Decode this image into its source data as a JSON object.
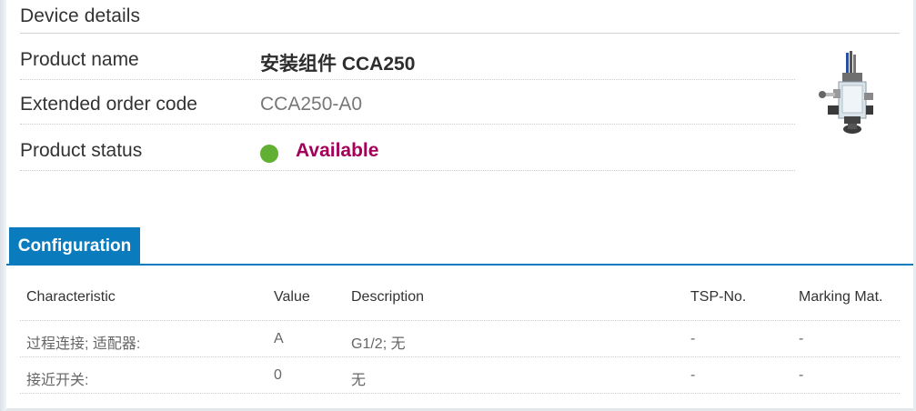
{
  "device_details": {
    "title": "Device details",
    "rows": [
      {
        "label": "Product name",
        "value": "安装组件 CCA250"
      },
      {
        "label": "Extended order code",
        "value": "CCA250-A0"
      },
      {
        "label": "Product status",
        "value": "Available"
      }
    ],
    "status_color": "#62b033",
    "status_text_color": "#a3005a"
  },
  "tabs": [
    {
      "label": "Configuration",
      "active": true
    }
  ],
  "configuration_table": {
    "headers": [
      "Characteristic",
      "Value",
      "Description",
      "TSP-No.",
      "Marking Mat."
    ],
    "rows": [
      [
        "过程连接; 适配器:",
        "A",
        "G1/2; 无",
        "-",
        "-"
      ],
      [
        "接近开关:",
        "0",
        "无",
        "-",
        "-"
      ]
    ]
  },
  "colors": {
    "accent": "#0a7bbd",
    "text": "#333333",
    "muted_text": "#777777"
  },
  "icons": {
    "product_image": "sensor-assembly-image"
  }
}
